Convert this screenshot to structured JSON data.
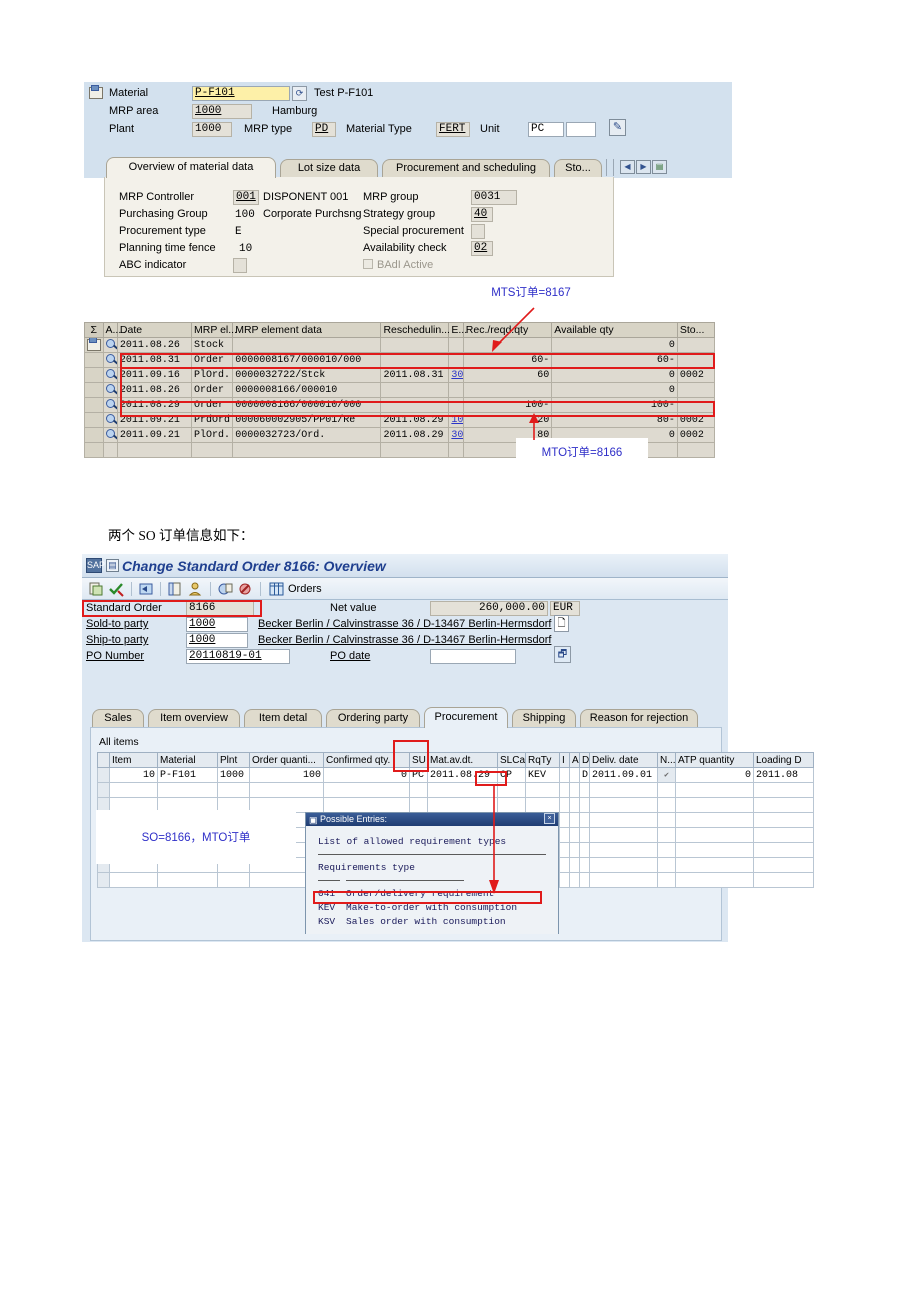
{
  "doc": {
    "caption_between": "两个 SO 订单信息如下："
  },
  "mrp_screen": {
    "header": {
      "material_label": "Material",
      "material_value": "P-F101",
      "material_desc": "Test P-F101",
      "mrp_area_label": "MRP area",
      "mrp_area_value": "1000",
      "mrp_area_desc": "Hamburg",
      "plant_label": "Plant",
      "plant_value": "1000",
      "mrp_type_label": "MRP type",
      "mrp_type_value": "PD",
      "material_type_label": "Material Type",
      "material_type_value": "FERT",
      "unit_label": "Unit",
      "unit_value": "PC"
    },
    "tabs": [
      {
        "label": "Overview of material data",
        "active": true
      },
      {
        "label": "Lot size data",
        "active": false
      },
      {
        "label": "Procurement and scheduling",
        "active": false
      },
      {
        "label": "Sto...",
        "active": false
      }
    ],
    "detail": {
      "mrp_controller_label": "MRP Controller",
      "mrp_controller_value": "001",
      "mrp_controller_desc": "DISPONENT 001",
      "mrp_group_label": "MRP group",
      "mrp_group_value": "0031",
      "purchasing_group_label": "Purchasing Group",
      "purchasing_group_value": "100",
      "purchasing_group_desc": "Corporate Purchsng",
      "strategy_group_label": "Strategy group",
      "strategy_group_value": "40",
      "procurement_type_label": "Procurement type",
      "procurement_type_value": "E",
      "special_procurement_label": "Special procurement",
      "special_procurement_value": "",
      "planning_time_fence_label": "Planning time fence",
      "planning_time_fence_value": "10",
      "availability_check_label": "Availability check",
      "availability_check_value": "02",
      "abc_indicator_label": "ABC indicator",
      "abc_indicator_value": "",
      "badi_active_label": "BAdI Active"
    },
    "table": {
      "columns": [
        "A...",
        "Date",
        "MRP el...",
        "MRP element data",
        "Reschedulin...",
        "E...",
        "Rec./reqd.qty",
        "Available qty",
        "Sto..."
      ],
      "rows": [
        {
          "date": "2011.08.26",
          "el": "Stock",
          "data": "",
          "resched": "",
          "e": "",
          "qty": "",
          "avail": "0",
          "sto": "",
          "blue": true,
          "highlight": false
        },
        {
          "date": "2011.08.31",
          "el": "Order",
          "data": "0000008167/000010/000",
          "resched": "",
          "e": "",
          "qty": "60-",
          "avail": "60-",
          "sto": "",
          "blue": false,
          "highlight": true
        },
        {
          "date": "2011.09.16",
          "el": "PlOrd.",
          "data": "0000032722/Stck",
          "resched": "2011.08.31",
          "e": "30",
          "qty": "60",
          "avail": "0",
          "sto": "0002",
          "blue": false,
          "highlight": false
        },
        {
          "date": "2011.08.26",
          "el": "Order",
          "data": "0000008166/000010",
          "resched": "",
          "e": "",
          "qty": "",
          "avail": "0",
          "sto": "",
          "blue": true,
          "highlight": false
        },
        {
          "date": "2011.08.29",
          "el": "Order",
          "data": "0000008166/000010/000",
          "resched": "",
          "e": "",
          "qty": "100-",
          "avail": "100-",
          "sto": "",
          "blue": false,
          "highlight": true
        },
        {
          "date": "2011.09.21",
          "el": "PrdOrd",
          "data": "000060002905/PP01/Re",
          "resched": "2011.08.29",
          "e": "10",
          "qty": "20",
          "avail": "80-",
          "sto": "0002",
          "blue": false,
          "highlight": false
        },
        {
          "date": "2011.09.21",
          "el": "PlOrd.",
          "data": "0000032723/Ord.",
          "resched": "2011.08.29",
          "e": "30",
          "qty": "80",
          "avail": "0",
          "sto": "0002",
          "blue": false,
          "highlight": false
        }
      ]
    },
    "annotations": {
      "mts_note": "MTS订单=8167",
      "mto_note": "MTO订单=8166"
    }
  },
  "so_screen": {
    "title": "Change Standard Order 8166: Overview",
    "toolbar": {
      "orders_label": "Orders"
    },
    "header": {
      "standard_order_label": "Standard Order",
      "standard_order_value": "8166",
      "net_value_label": "Net value",
      "net_value_amount": "260,000.00",
      "net_value_currency": "EUR",
      "sold_to_label": "Sold-to party",
      "sold_to_value": "1000",
      "sold_to_desc": "Becker Berlin / Calvinstrasse 36 / D-13467 Berlin-Hermsdorf",
      "ship_to_label": "Ship-to party",
      "ship_to_value": "1000",
      "ship_to_desc": "Becker Berlin / Calvinstrasse 36 / D-13467 Berlin-Hermsdorf",
      "po_number_label": "PO Number",
      "po_number_value": "20110819-01",
      "po_date_label": "PO date",
      "po_date_value": ""
    },
    "tabs": [
      {
        "label": "Sales",
        "active": false
      },
      {
        "label": "Item overview",
        "active": false
      },
      {
        "label": "Item detal",
        "active": false
      },
      {
        "label": "Ordering party",
        "active": false
      },
      {
        "label": "Procurement",
        "active": true
      },
      {
        "label": "Shipping",
        "active": false
      },
      {
        "label": "Reason for rejection",
        "active": false
      }
    ],
    "items": {
      "section_label": "All items",
      "columns": [
        "Item",
        "Material",
        "Plnt",
        "Order quanti...",
        "Confirmed qty.",
        "SU",
        "Mat.av.dt.",
        "SLCa",
        "RqTy",
        "I",
        "A",
        "D",
        "Deliv. date",
        "N...",
        "ATP quantity",
        "Loading D"
      ],
      "rows": [
        {
          "item": "10",
          "material": "P-F101",
          "plnt": "1000",
          "order_qty": "100",
          "confirmed_qty": "0",
          "su": "PC",
          "mat_av_dt": "2011.08.29",
          "slca": "CP",
          "rqty": "KEV",
          "i": "",
          "a": "",
          "d": "D",
          "deliv_date": "2011.09.01",
          "n": "checked",
          "atp_qty": "0",
          "loading_d": "2011.08"
        }
      ]
    },
    "possible_entries": {
      "title": "Possible Entries:",
      "heading": "List of allowed requirement types",
      "column_label": "Requirements type",
      "entries": [
        {
          "code": "041",
          "text": "Order/delivery requirement",
          "highlight": false
        },
        {
          "code": "KEV",
          "text": "Make-to-order with consumption",
          "highlight": true
        },
        {
          "code": "KSV",
          "text": "Sales order with consumption",
          "highlight": false
        }
      ]
    },
    "annotations": {
      "so_note": "SO=8166，MTO订单"
    }
  },
  "colors": {
    "accent_red": "#e01b1b",
    "annotation_blue": "#2f2fc8",
    "sap_blue": "#1f3f8f"
  }
}
